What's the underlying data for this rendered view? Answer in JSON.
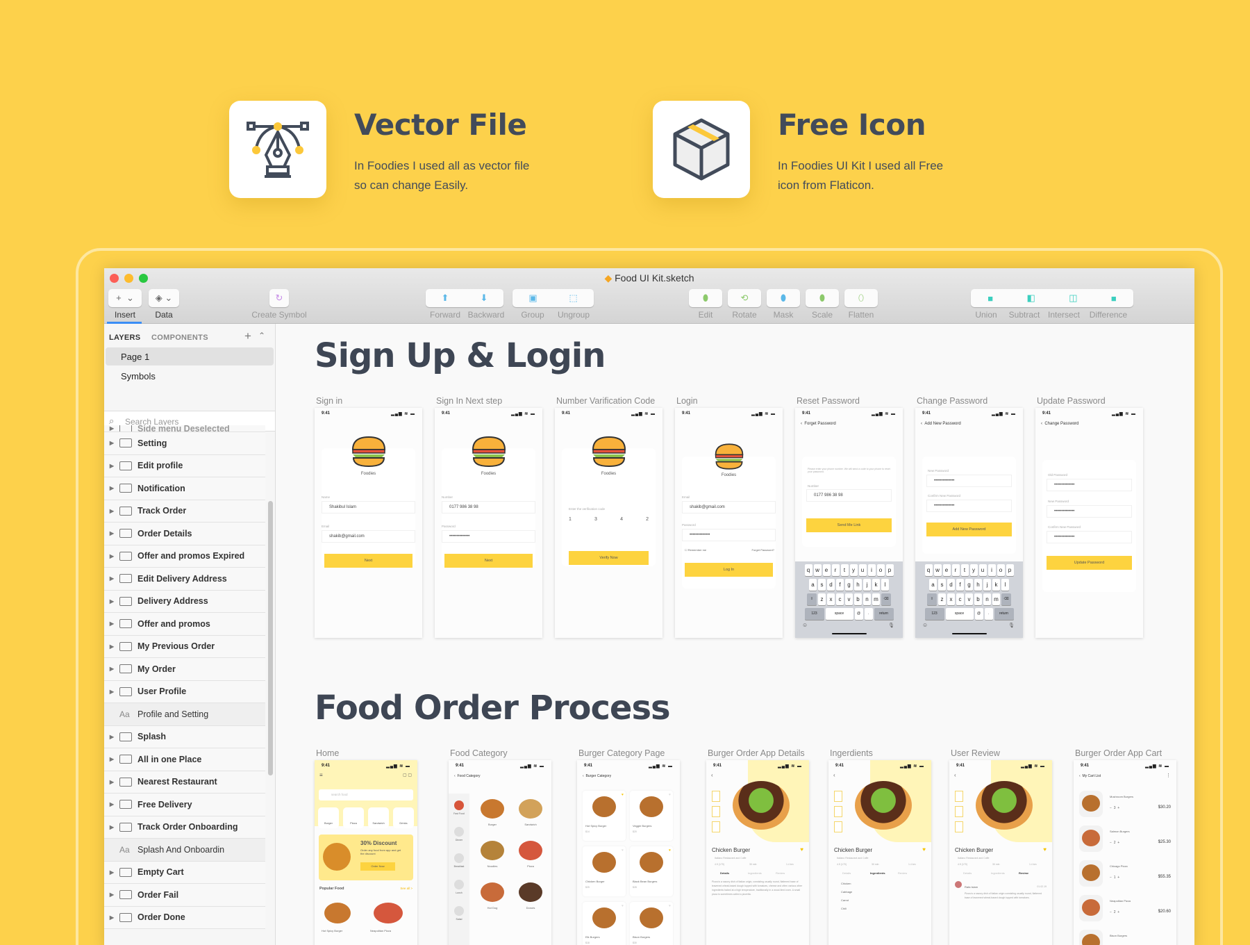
{
  "features": [
    {
      "title": "Vector File",
      "desc_line1": "In Foodies I used all as vector file",
      "desc_line2": "so can change Easily.",
      "icon": "pen-tool-icon"
    },
    {
      "title": "Free Icon",
      "desc_line1": "In Foodies UI Kit I used all Free",
      "desc_line2": "icon from Flaticon.",
      "icon": "box-icon"
    }
  ],
  "window": {
    "title": "Food UI Kit.sketch"
  },
  "toolbar": {
    "insert": "Insert",
    "data": "Data",
    "create_symbol": "Create Symbol",
    "forward": "Forward",
    "backward": "Backward",
    "group": "Group",
    "ungroup": "Ungroup",
    "edit": "Edit",
    "rotate": "Rotate",
    "mask": "Mask",
    "scale": "Scale",
    "flatten": "Flatten",
    "union": "Union",
    "subtract": "Subtract",
    "intersect": "Intersect",
    "difference": "Difference"
  },
  "sidebar": {
    "tab_layers": "LAYERS",
    "tab_components": "COMPONENTS",
    "pages": [
      "Page 1",
      "Symbols"
    ],
    "search_placeholder": "Search Layers",
    "layers": [
      {
        "label": "Side menu Deselected",
        "type": "artboard"
      },
      {
        "label": "Setting",
        "type": "artboard"
      },
      {
        "label": "Edit profile",
        "type": "artboard"
      },
      {
        "label": "Notification",
        "type": "artboard"
      },
      {
        "label": "Track Order",
        "type": "artboard"
      },
      {
        "label": "Order Details",
        "type": "artboard"
      },
      {
        "label": "Offer and promos Expired",
        "type": "artboard"
      },
      {
        "label": "Edit Delivery Address",
        "type": "artboard"
      },
      {
        "label": "Delivery Address",
        "type": "artboard"
      },
      {
        "label": "Offer and promos",
        "type": "artboard"
      },
      {
        "label": "My Previous Order",
        "type": "artboard"
      },
      {
        "label": "My Order",
        "type": "artboard"
      },
      {
        "label": "User Profile",
        "type": "artboard"
      },
      {
        "label": "Profile and Setting",
        "type": "text"
      },
      {
        "label": "Splash",
        "type": "artboard"
      },
      {
        "label": "All in one Place",
        "type": "artboard"
      },
      {
        "label": "Nearest Restaurant",
        "type": "artboard"
      },
      {
        "label": "Free Delivery",
        "type": "artboard"
      },
      {
        "label": "Track Order Onboarding",
        "type": "artboard"
      },
      {
        "label": "Splash And Onboardin",
        "type": "text"
      },
      {
        "label": "Empty Cart",
        "type": "artboard"
      },
      {
        "label": "Order Fail",
        "type": "artboard"
      },
      {
        "label": "Order Done",
        "type": "artboard"
      }
    ]
  },
  "canvas": {
    "section1": "Sign Up & Login",
    "section2": "Food Order Process",
    "row1_labels": [
      "Sign in",
      "Sign In Next step",
      "Number Varification Code",
      "Login",
      "Reset Password",
      "Change Password",
      "Update Password"
    ],
    "row2_labels": [
      "Home",
      "Food Category",
      "Burger Category Page",
      "Burger Order App Details",
      "Ingerdients",
      "User Review",
      "Burger Order App Cart"
    ]
  },
  "phone": {
    "time": "9:41",
    "signal": "▂▄▆ ≋ ▬",
    "brand": "Foodies",
    "signin": {
      "name_label": "Name",
      "name": "Shakibul Islam",
      "email_label": "Email",
      "email": "shakib@gmail.com",
      "button": "Next"
    },
    "next": {
      "number_label": "Number",
      "number": "0177 986 38 98",
      "password_label": "Password",
      "password": "••••••••••••••",
      "button": "Next"
    },
    "verify": {
      "prompt": "Enter the verification code",
      "digits": [
        "1",
        "3",
        "4",
        "2"
      ],
      "button": "Verify Now"
    },
    "login": {
      "email_label": "Email",
      "email": "shakib@gmail.com",
      "password_label": "Password",
      "password": "••••••••••••••",
      "remember": "Remember me",
      "forgot": "Forget Password?",
      "button": "Log In"
    },
    "reset": {
      "header": "Forget Password",
      "info": "Please enter your phone number. We will send a code to your phone to reset your password.",
      "number_label": "Number",
      "number": "0177 986 38 98",
      "button": "Send Me Link"
    },
    "change": {
      "header": "Add New Password",
      "new_label": "New Password",
      "confirm_label": "Confirm New Password",
      "password": "••••••••••••••",
      "button": "Add New Password"
    },
    "update": {
      "header": "Change Password",
      "old_label": "Old Password",
      "new_label": "New Password",
      "confirm_label": "Confirm New Password",
      "password": "••••••••••••••",
      "button": "Update Password"
    },
    "keyboard": {
      "row1": [
        "q",
        "w",
        "e",
        "r",
        "t",
        "y",
        "u",
        "i",
        "o",
        "p"
      ],
      "row2": [
        "a",
        "s",
        "d",
        "f",
        "g",
        "h",
        "j",
        "k",
        "l"
      ],
      "row3": [
        "z",
        "x",
        "c",
        "v",
        "b",
        "n",
        "m"
      ],
      "num": "123",
      "space": "space",
      "at": "@",
      "dot": ".",
      "return": "return"
    },
    "home": {
      "search": "search food",
      "categories": [
        "Burger",
        "Pizza",
        "Sandwich",
        "Drinks"
      ],
      "promo_title": "30% Discount",
      "promo_text": "Order any food from app and get the discount",
      "promo_button": "Order Now",
      "popular": "Popular Food",
      "see_all": "See all >",
      "items": [
        "Hot Spicy Burger",
        "Neapolitan Pizza"
      ]
    },
    "food_category": {
      "header": "Food Category",
      "side": [
        "Fast Food",
        "Dinner",
        "Breakfast",
        "Lunch",
        "Salad"
      ],
      "items": [
        "Burger",
        "Sandwich",
        "Noodles",
        "Pizza",
        "Hot Dog",
        "Donuts"
      ]
    },
    "burger_category": {
      "header": "Burger Category",
      "items": [
        {
          "name": "Hot Spicy Burger",
          "price": "$14"
        },
        {
          "name": "Veggie Burgers",
          "price": "$20"
        },
        {
          "name": "Chicken Burger",
          "price": "$25"
        },
        {
          "name": "Black Bean Burgers",
          "price": "$28"
        },
        {
          "name": "Elk Burgers",
          "price": "$18"
        },
        {
          "name": "Bison Burgers",
          "price": "$30"
        }
      ]
    },
    "details": {
      "title": "Chicken Burger",
      "restaurant": "Italiano Restaurant and Coffe",
      "rating": "4.5 (170)",
      "time": "30 min",
      "distance": "1.4 km",
      "tabs": [
        "Details",
        "Ingredients",
        "Review"
      ],
      "desc": "Pizza is a savory dish of Italian origin, consisting usually round, flattened base of leavened wheat-based dough topped with tomatoes, cheese and often various other ingredients baked at a high temperature, traditionally in a wood-fired oven. A small pizza is sometimes called a pizzetta.",
      "ingredients": [
        "Chicken",
        "Cabbage",
        "Carrot",
        "Chili"
      ],
      "reviewer": "Rafa Islam",
      "review_date": "01.02.19",
      "review": "Pizza is a savory dish of Italian origin consisting usually round, flattened base of leavened wheat-based dough topped with tomatoes."
    },
    "cart": {
      "header": "My Cart List",
      "items": [
        {
          "name": "Mushroom Burgers",
          "qty": "3",
          "price": "$30.20"
        },
        {
          "name": "Salmon Burgers",
          "qty": "2",
          "price": "$25.30"
        },
        {
          "name": "Chicago Pizza",
          "qty": "1",
          "price": "$55.35"
        },
        {
          "name": "Neapolitan Pizza",
          "qty": "2",
          "price": "$20.60"
        },
        {
          "name": "Bison Burgers",
          "qty": "",
          "price": ""
        }
      ]
    }
  },
  "colors": {
    "background": "#fdd14b",
    "accent": "#fdd33f",
    "text_dark": "#424b5a",
    "canvas": "#f9f9f9"
  }
}
